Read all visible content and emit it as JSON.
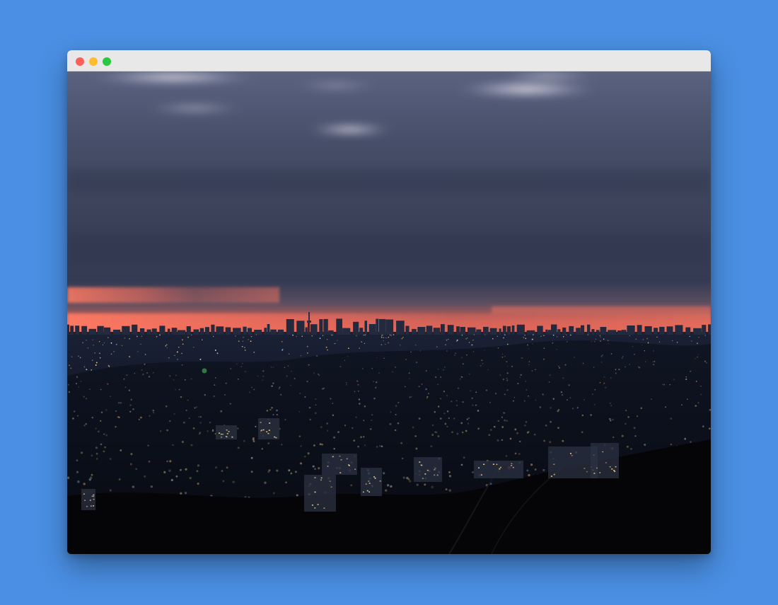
{
  "window": {
    "controls": {
      "close_color": "#fe5f57",
      "minimize_color": "#febc2e",
      "maximize_color": "#28c840"
    }
  },
  "photo": {
    "subject": "city-skyline-at-dusk",
    "colors": {
      "sky_top": "#4c5570",
      "sky_mid": "#3d4660",
      "horizon_glow": "#f26a55",
      "city_dark": "#10131e",
      "foreground": "#050507",
      "light_warm": "#ffd58a",
      "light_green": "#5dff7a"
    }
  }
}
